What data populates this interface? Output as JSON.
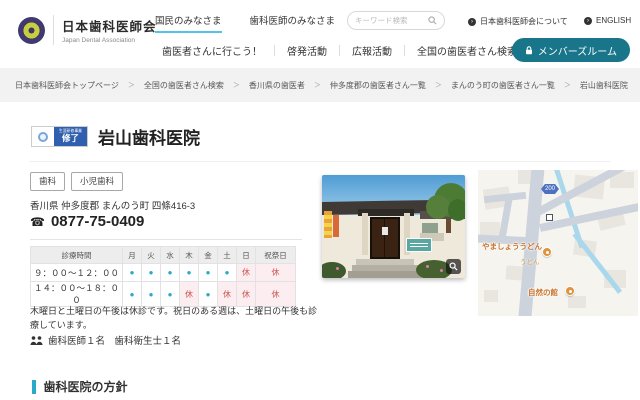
{
  "header": {
    "logo": {
      "title": "日本歯科医師会",
      "subtitle": "Japan Dental Association"
    },
    "nav_top": [
      {
        "label": "国民のみなさま",
        "active": true
      },
      {
        "label": "歯科医師のみなさま",
        "active": false
      }
    ],
    "search": {
      "placeholder": "キーワード検索"
    },
    "utility_links": [
      "日本歯科医師会について",
      "ENGLISH"
    ],
    "utility_icon_glyph": "›",
    "nav_bottom": [
      "歯医者さんに行こう！",
      "啓発活動",
      "広報活動",
      "全国の歯医者さん検索"
    ],
    "members_button": "メンバーズルーム"
  },
  "breadcrumb": {
    "separator": "＞",
    "items": [
      "日本歯科医師会トップページ",
      "全国の歯医者さん検索",
      "香川県の歯医者",
      "仲多度郡の歯医者さん一覧",
      "まんのう町の歯医者さん一覧",
      "岩山歯科医院"
    ]
  },
  "clinic": {
    "badge": {
      "small_text": "生涯研修事業",
      "large_text": "修了"
    },
    "name": "岩山歯科医院",
    "tags": [
      "歯科",
      "小児歯科"
    ],
    "address": "香川県 仲多度郡 まんのう町 四條416-3",
    "phone": "0877-75-0409",
    "phone_glyph": "☎",
    "schedule": {
      "header": [
        "診療時間",
        "月",
        "火",
        "水",
        "木",
        "金",
        "土",
        "日",
        "祝祭日"
      ],
      "open_symbol": "●",
      "closed_symbol": "休",
      "rows": [
        {
          "time": "９：００～１２：００",
          "cells": [
            "●",
            "●",
            "●",
            "●",
            "●",
            "●",
            "休",
            "休"
          ]
        },
        {
          "time": "１４：００～１８：００",
          "cells": [
            "●",
            "●",
            "●",
            "休",
            "●",
            "休",
            "休",
            "休"
          ]
        }
      ]
    },
    "note": "木曜日と土曜日の午後は休診です。祝日のある週は、土曜日の午後も診療しています。",
    "staff": "歯科医師１名　歯科衛生士１名"
  },
  "map": {
    "route_number": "200",
    "pois": [
      {
        "label": "やましょううどん",
        "sublabel": "うどん"
      },
      {
        "label": "自然の館"
      }
    ]
  },
  "section_heading": "歯科医院の方針",
  "colors": {
    "accent_teal": "#19758a",
    "active_underline": "#53c3e9",
    "schedule_open": "#2aa8c9",
    "schedule_closed_text": "#c9554f",
    "schedule_closed_bg": "#fcedf0",
    "badge_blue": "#2f5fae",
    "breadcrumb_bg": "#f2f2f2"
  }
}
